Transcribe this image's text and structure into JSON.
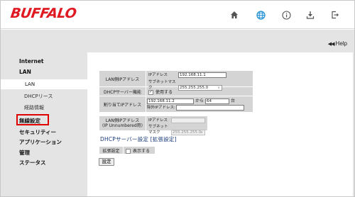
{
  "header": {
    "logo_text": "BUFFALO",
    "brand_color": "#e01a22",
    "accent_color": "#1e8fd6",
    "icons": [
      "home-icon",
      "globe-icon",
      "info-icon",
      "download-icon",
      "logout-icon"
    ]
  },
  "help": {
    "label": "Help"
  },
  "sidebar": {
    "internet": "Internet",
    "lan": "LAN",
    "lan_sub": "LAN",
    "dhcp_lease": "DHCPリース",
    "route": "経路情報",
    "wireless": "無線設定",
    "security": "セキュリティー",
    "application": "アプリケーション",
    "admin": "管理",
    "status": "ステータス"
  },
  "form": {
    "lan_ip_label": "LAN側IPアドレス",
    "ip_address_label": "IPアドレス",
    "ip_address_value": "192.168.11.1",
    "subnet_label": "サブネットマスク",
    "subnet_value": "255.255.255.0",
    "dhcp_server_label": "DHCPサーバー機能",
    "dhcp_server_checkbox_label": "使用する",
    "dhcp_server_enabled": true,
    "assign_ip_label": "割り当てIPアドレス",
    "assign_start": "192.168.11.2",
    "assign_from": "から",
    "assign_count": "64",
    "assign_unit": "台",
    "exclude_label": "除外IPアドレス:",
    "exclude_value": "",
    "unnumbered_label_line1": "LAN側IPアドレス",
    "unnumbered_label_line2": "(IP Unnumbered用)",
    "unnumbered_ip_label": "IPアドレス",
    "unnumbered_ip_value": "",
    "unnumbered_subnet_label": "サブネットマスク",
    "unnumbered_subnet_value": "255.255.255.0",
    "dhcp_extended_title": "DHCPサーバー設定 [拡張設定]",
    "extended_label": "拡張設定",
    "extended_checkbox_label": "表示する",
    "extended_enabled": false,
    "submit_label": "設定"
  }
}
